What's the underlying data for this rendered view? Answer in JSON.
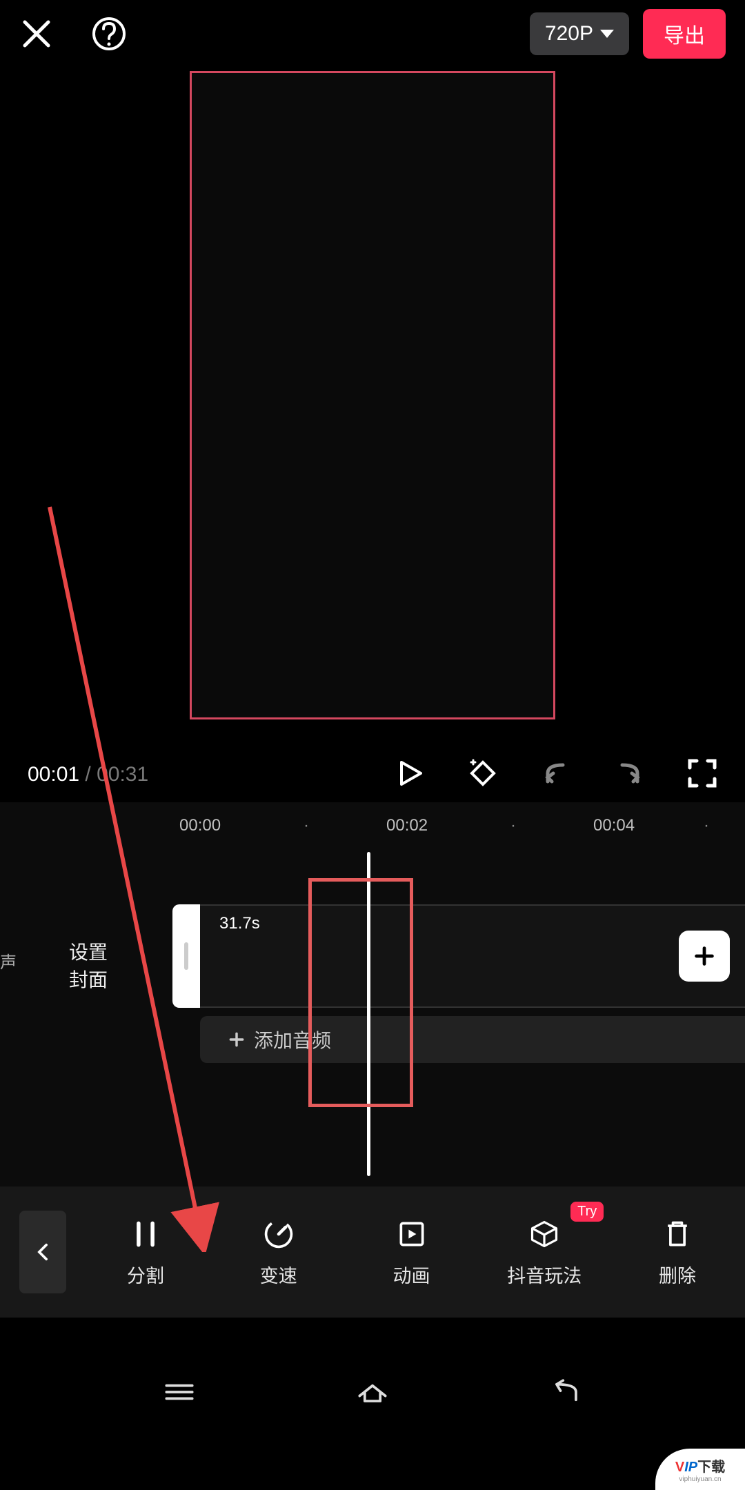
{
  "topbar": {
    "resolution": "720P",
    "export_label": "导出"
  },
  "player": {
    "current_time": "00:01",
    "total_time": "00:31"
  },
  "timeline": {
    "ticks": {
      "t0": "00:00",
      "t2": "00:02",
      "t4": "00:04"
    },
    "cover_label": "设置\n封面",
    "clip_duration": "31.7s",
    "add_audio_label": "添加音频",
    "edge_label": "声"
  },
  "tools": {
    "split": "分割",
    "speed": "变速",
    "animation": "动画",
    "douyin_play": "抖音玩法",
    "delete": "删除",
    "try_badge": "Try"
  },
  "watermark": {
    "top": "VIP下载",
    "sub": "viphuiyuan.cn"
  }
}
